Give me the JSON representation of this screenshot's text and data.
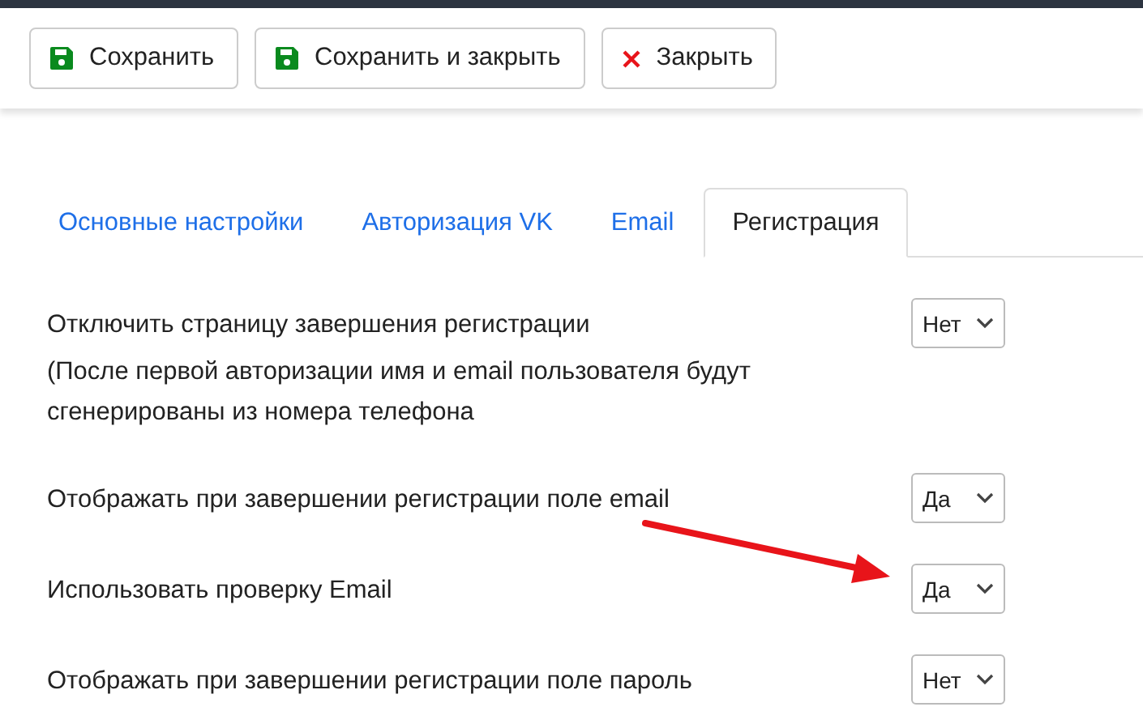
{
  "toolbar": {
    "buttons": [
      {
        "label": "Сохранить",
        "kind": "save"
      },
      {
        "label": "Сохранить и закрыть",
        "kind": "save"
      },
      {
        "label": "Закрыть",
        "kind": "close"
      }
    ]
  },
  "tabs": [
    {
      "label": "Основные настройки",
      "selected": false
    },
    {
      "label": "Авторизация VK",
      "selected": false
    },
    {
      "label": "Email",
      "selected": false
    },
    {
      "label": "Регистрация",
      "selected": true
    }
  ],
  "settings": [
    {
      "label": "Отключить страницу завершения регистрации",
      "note": "(После первой авторизации имя и email пользователя будут сгенерированы из номера телефона",
      "value": "Нет"
    },
    {
      "label": "Отображать при завершении регистрации поле email",
      "value": "Да"
    },
    {
      "label": "Использовать проверку Email",
      "value": "Да"
    },
    {
      "label": "Отображать при завершении регистрации поле пароль",
      "value": "Нет"
    }
  ]
}
